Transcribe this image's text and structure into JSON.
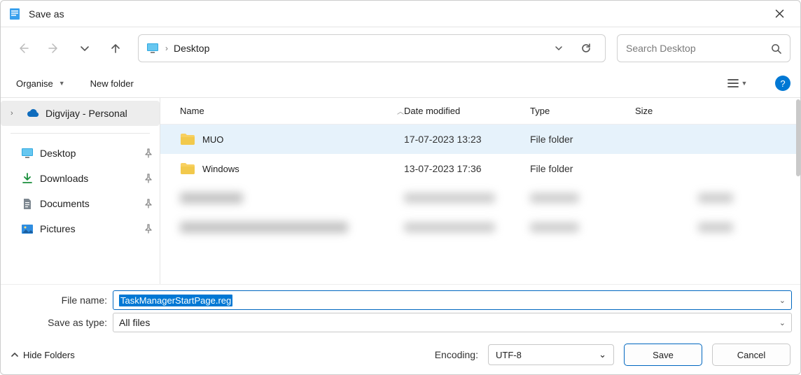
{
  "window": {
    "title": "Save as"
  },
  "address": {
    "location": "Desktop"
  },
  "search": {
    "placeholder": "Search Desktop"
  },
  "commands": {
    "organise": "Organise",
    "new_folder": "New folder"
  },
  "navpane": {
    "account": "Digvijay - Personal",
    "quick": [
      {
        "label": "Desktop"
      },
      {
        "label": "Downloads"
      },
      {
        "label": "Documents"
      },
      {
        "label": "Pictures"
      }
    ]
  },
  "columns": {
    "name": "Name",
    "date": "Date modified",
    "type": "Type",
    "size": "Size"
  },
  "rows": [
    {
      "name": "MUO",
      "date": "17-07-2023 13:23",
      "type": "File folder",
      "size": "",
      "selected": true
    },
    {
      "name": "Windows",
      "date": "13-07-2023 17:36",
      "type": "File folder",
      "size": "",
      "selected": false
    }
  ],
  "fields": {
    "file_name_label": "File name:",
    "file_name_value": "TaskManagerStartPage.reg",
    "save_type_label": "Save as type:",
    "save_type_value": "All files"
  },
  "footer": {
    "hide_folders": "Hide Folders",
    "encoding_label": "Encoding:",
    "encoding_value": "UTF-8",
    "save": "Save",
    "cancel": "Cancel"
  }
}
